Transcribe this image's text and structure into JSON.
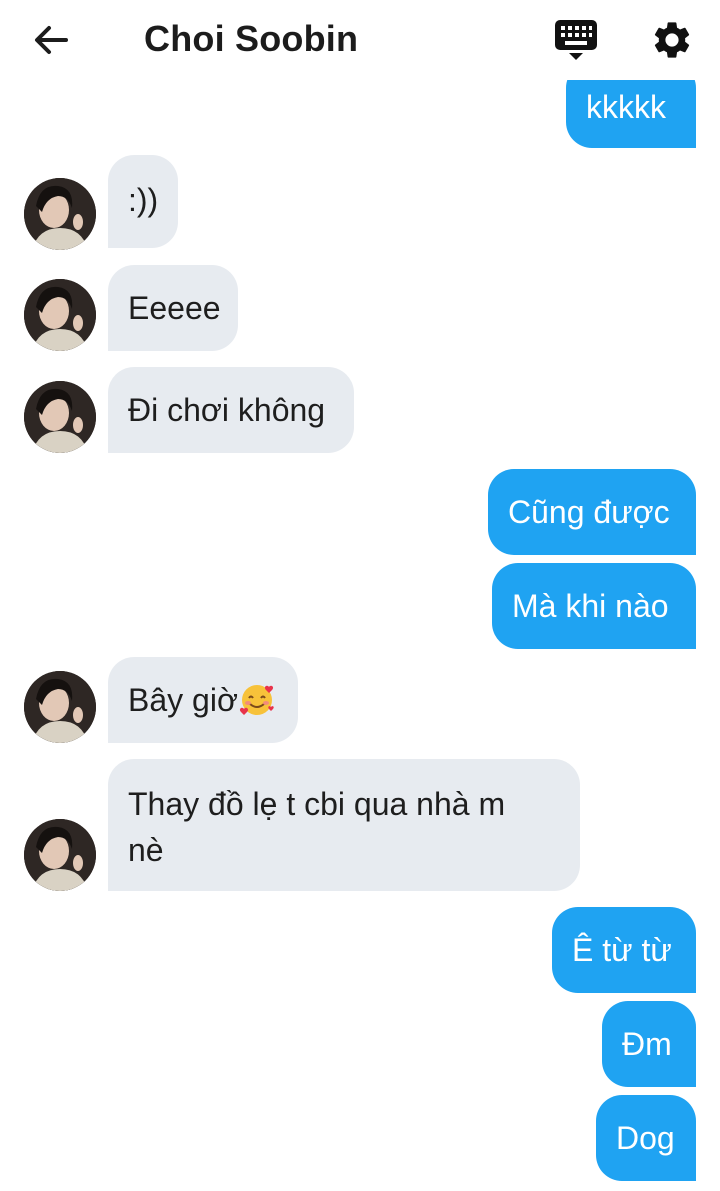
{
  "header": {
    "title": "Choi Soobin",
    "back_icon": "arrow-left-icon",
    "keyboard_icon": "keyboard-icon",
    "settings_icon": "gear-icon"
  },
  "colors": {
    "incoming_bubble": "#e7ebf0",
    "outgoing_bubble": "#1fa3f2",
    "text_dark": "#1e1e1e",
    "text_light": "#ffffff"
  },
  "messages": [
    {
      "direction": "outgoing",
      "text": "kkkkk"
    },
    {
      "direction": "incoming",
      "text": ":))"
    },
    {
      "direction": "incoming",
      "text": "Eeeee"
    },
    {
      "direction": "incoming",
      "text": "Đi chơi không"
    },
    {
      "direction": "outgoing",
      "text": "Cũng được"
    },
    {
      "direction": "outgoing",
      "text": "Mà khi nào"
    },
    {
      "direction": "incoming",
      "text": "Bây giờ",
      "emoji": "smiling-face-with-hearts"
    },
    {
      "direction": "incoming",
      "text_line1": "Thay đồ lẹ t cbi qua nhà m",
      "text_line2": "nè"
    },
    {
      "direction": "outgoing",
      "text": "Ê từ từ"
    },
    {
      "direction": "outgoing",
      "text": "Đm"
    },
    {
      "direction": "outgoing",
      "text": "Dog"
    }
  ]
}
